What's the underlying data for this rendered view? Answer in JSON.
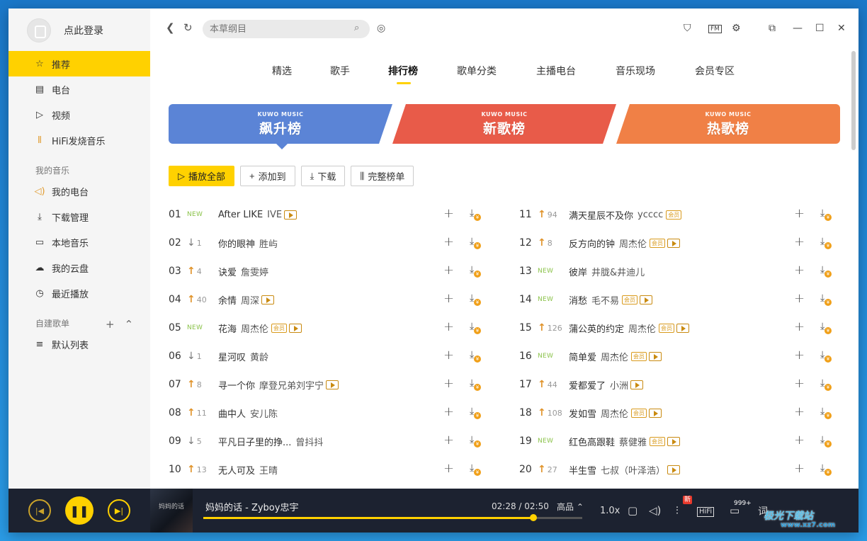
{
  "sidebar": {
    "login_text": "点此登录",
    "nav": [
      {
        "label": "推荐",
        "icon": "star-icon",
        "active": true
      },
      {
        "label": "电台",
        "icon": "radio-icon"
      },
      {
        "label": "视频",
        "icon": "video-icon"
      },
      {
        "label": "HiFi发烧音乐",
        "icon": "hifi-wave-icon"
      }
    ],
    "my_music_title": "我的音乐",
    "my_music": [
      {
        "label": "我的电台",
        "icon": "speaker-icon"
      },
      {
        "label": "下载管理",
        "icon": "download-icon"
      },
      {
        "label": "本地音乐",
        "icon": "monitor-icon"
      },
      {
        "label": "我的云盘",
        "icon": "cloud-icon"
      },
      {
        "label": "最近播放",
        "icon": "clock-icon"
      }
    ],
    "playlists_title": "自建歌单",
    "playlists": [
      {
        "label": "默认列表",
        "icon": "playlist-icon"
      }
    ]
  },
  "topbar": {
    "search_placeholder": "本草纲目"
  },
  "tabs": [
    "精选",
    "歌手",
    "排行榜",
    "歌单分类",
    "主播电台",
    "音乐现场",
    "会员专区"
  ],
  "active_tab": 2,
  "banners": [
    {
      "brand": "KUWO MUSIC",
      "title": "飙升榜",
      "color": "#5b84d6"
    },
    {
      "brand": "KUWO MUSIC",
      "title": "新歌榜",
      "color": "#e85b49"
    },
    {
      "brand": "KUWO MUSIC",
      "title": "热歌榜",
      "color": "#f08046"
    }
  ],
  "actions": {
    "play_all": "播放全部",
    "add_to": "添加到",
    "download": "下载",
    "full_list": "完整榜单"
  },
  "songs": [
    {
      "rank": "01",
      "trend": "new",
      "change": "NEW",
      "title": "After LIKE",
      "artist": "IVE",
      "vip": false,
      "mv": true
    },
    {
      "rank": "02",
      "trend": "down",
      "change": "1",
      "title": "你的眼神",
      "artist": "胜屿",
      "vip": false,
      "mv": false
    },
    {
      "rank": "03",
      "trend": "up",
      "change": "4",
      "title": "诀爱",
      "artist": "詹雯婷",
      "vip": false,
      "mv": false
    },
    {
      "rank": "04",
      "trend": "up",
      "change": "40",
      "title": "余情",
      "artist": "周深",
      "vip": false,
      "mv": true
    },
    {
      "rank": "05",
      "trend": "new",
      "change": "NEW",
      "title": "花海",
      "artist": "周杰伦",
      "vip": true,
      "mv": true
    },
    {
      "rank": "06",
      "trend": "down",
      "change": "1",
      "title": "星河叹",
      "artist": "黄龄",
      "vip": false,
      "mv": false
    },
    {
      "rank": "07",
      "trend": "up",
      "change": "8",
      "title": "寻一个你",
      "artist": "摩登兄弟刘宇宁",
      "vip": false,
      "mv": true
    },
    {
      "rank": "08",
      "trend": "up",
      "change": "11",
      "title": "曲中人",
      "artist": "安儿陈",
      "vip": false,
      "mv": false
    },
    {
      "rank": "09",
      "trend": "down",
      "change": "5",
      "title": "平凡日子里的挣...",
      "artist": "曾抖抖",
      "vip": false,
      "mv": false
    },
    {
      "rank": "10",
      "trend": "up",
      "change": "13",
      "title": "无人可及",
      "artist": "王晴",
      "vip": false,
      "mv": false
    },
    {
      "rank": "11",
      "trend": "up",
      "change": "94",
      "title": "满天星辰不及你",
      "artist": "ycccc",
      "vip": true,
      "mv": false
    },
    {
      "rank": "12",
      "trend": "up",
      "change": "8",
      "title": "反方向的钟",
      "artist": "周杰伦",
      "vip": true,
      "mv": true
    },
    {
      "rank": "13",
      "trend": "new",
      "change": "NEW",
      "title": "彼岸",
      "artist": "井胧&井迪儿",
      "vip": false,
      "mv": false
    },
    {
      "rank": "14",
      "trend": "new",
      "change": "NEW",
      "title": "消愁",
      "artist": "毛不易",
      "vip": true,
      "mv": true
    },
    {
      "rank": "15",
      "trend": "up",
      "change": "126",
      "title": "蒲公英的约定",
      "artist": "周杰伦",
      "vip": true,
      "mv": true
    },
    {
      "rank": "16",
      "trend": "new",
      "change": "NEW",
      "title": "简单爱",
      "artist": "周杰伦",
      "vip": true,
      "mv": true
    },
    {
      "rank": "17",
      "trend": "up",
      "change": "44",
      "title": "爱都爱了",
      "artist": "小洲",
      "vip": false,
      "mv": true
    },
    {
      "rank": "18",
      "trend": "up",
      "change": "108",
      "title": "发如雪",
      "artist": "周杰伦",
      "vip": true,
      "mv": true
    },
    {
      "rank": "19",
      "trend": "new",
      "change": "NEW",
      "title": "红色高跟鞋",
      "artist": "蔡健雅",
      "vip": true,
      "mv": true
    },
    {
      "rank": "20",
      "trend": "up",
      "change": "27",
      "title": "半生雪",
      "artist": "七叔（叶泽浩）",
      "vip": false,
      "mv": true
    }
  ],
  "vip_tag": "会员",
  "player": {
    "cover_text": "妈妈的话",
    "title": "妈妈的话 - Zyboy忠宇",
    "time": "02:28 / 02:50",
    "progress": 0.871,
    "quality": "高品 ⌃",
    "speed": "1.0x",
    "hifi": "HiFi",
    "new_badge": "新",
    "comment_count": "999+",
    "lyrics": "词"
  },
  "watermark": {
    "text": "极光下载站",
    "url": "www.xz7.com"
  }
}
